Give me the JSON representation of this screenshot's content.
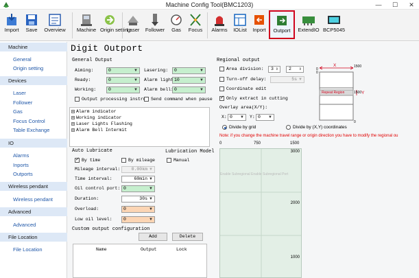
{
  "window": {
    "title": "Machine Config Tool(BMC1203)",
    "minimize": "—",
    "maximize": "☐",
    "close": "✕"
  },
  "toolbar": {
    "items": [
      {
        "label": "Import",
        "icon": "import-icon"
      },
      {
        "label": "Save",
        "icon": "save-icon"
      },
      {
        "label": "Overview",
        "icon": "overview-icon"
      },
      {
        "label": "Machine",
        "icon": "machine-icon"
      },
      {
        "label": "Origin setting",
        "icon": "origin-icon"
      },
      {
        "label": "Laser",
        "icon": "laser-icon"
      },
      {
        "label": "Follower",
        "icon": "follower-icon"
      },
      {
        "label": "Gas",
        "icon": "gas-icon"
      },
      {
        "label": "Focus",
        "icon": "focus-icon"
      },
      {
        "label": "Alarms",
        "icon": "alarms-icon"
      },
      {
        "label": "IOList",
        "icon": "iolist-icon"
      },
      {
        "label": "Inport",
        "icon": "inport-icon"
      },
      {
        "label": "Outport",
        "icon": "outport-icon"
      },
      {
        "label": "ExtendIO",
        "icon": "extendio-icon"
      },
      {
        "label": "BCP5045",
        "icon": "bcp5045-icon"
      }
    ],
    "selected": "Outport"
  },
  "sidebar": {
    "groups": [
      {
        "title": "Machine",
        "items": [
          "General",
          "Origin setting"
        ]
      },
      {
        "title": "Devices",
        "items": [
          "Laser",
          "Follower",
          "Gas",
          "Focus Control",
          "Table Exchange"
        ]
      },
      {
        "title": "IO",
        "items": [
          "Alarms",
          "Inports",
          "Outports"
        ]
      },
      {
        "title": "Wireless pendant",
        "items": [
          "Wireless pendant"
        ]
      },
      {
        "title": "Advanced",
        "items": [
          "Advanced"
        ]
      },
      {
        "title": "File Location",
        "items": [
          "File Location"
        ]
      }
    ]
  },
  "page": {
    "title": "Digit Outport",
    "general_output": {
      "heading": "General Output",
      "aiming": {
        "label": "Aiming:",
        "value": "0"
      },
      "lasering": {
        "label": "Lasering:",
        "value": "0"
      },
      "ready": {
        "label": "Ready:",
        "value": "0"
      },
      "alarm_light": {
        "label": "Alarm light",
        "value": "10"
      },
      "working": {
        "label": "Working:",
        "value": "0"
      },
      "alarm_bell": {
        "label": "Alarm bell:",
        "value": "0"
      },
      "output_processing": "Output processing instru",
      "send_command": "Send command when pause"
    },
    "tree": [
      "Alarm indicator",
      "Working indicator",
      "Laser Lights Flashing",
      "Alarm Bell Intermit"
    ],
    "auto_lubricate": {
      "heading": "Auto Lubricate",
      "by_time": "By time",
      "by_mileage": "By mileage",
      "mileage_interval": {
        "label": "Mileage interval:",
        "value": "0.00km"
      },
      "time_interval": {
        "label": "Time interval:",
        "value": "60min"
      },
      "oil_control_port": {
        "label": "Oil control port:",
        "value": "0"
      },
      "duration": {
        "label": "Duration:",
        "value": "30s"
      },
      "overload": {
        "label": "Overload:",
        "value": "0"
      },
      "low_oil_level": {
        "label": "Low oil level:",
        "value": "0"
      }
    },
    "lubrication_model": {
      "heading": "Lubrication Model",
      "manual": "Manual"
    },
    "custom_output": {
      "heading": "Custom output configuration",
      "add": "Add",
      "delete": "Delete",
      "columns": [
        "Name",
        "Output",
        "Lock"
      ]
    },
    "regional_output": {
      "heading": "Regional output",
      "area_division": {
        "label": "Area division:",
        "value1": "3",
        "value2": "2"
      },
      "turn_off_delay": {
        "label": "Turn-off delay:",
        "value": "5s"
      },
      "coordinate_edit": "Coordinate edit",
      "only_extract": "Only extract in cutting",
      "overlay_area": "Overlay area(X/Y):",
      "x": {
        "label": "X:",
        "value": "0"
      },
      "y": {
        "label": "Y:",
        "value": "0"
      },
      "divide_by_grid": "Divide by grid",
      "divide_by_xy": "Divide by (X,Y) coordinates",
      "note": "Note: if you change the machine travel range or origin direction you have to modify the regional ou",
      "diagram": {
        "x_label": "X",
        "y_label": "Y",
        "top_left": "0",
        "top_right": "1500",
        "bottom_left": "0",
        "left_num": "0",
        "right_num": "1500",
        "bottom_num": "0",
        "repeat_region": "Repeat Region"
      },
      "grid": {
        "x_ticks": [
          "0",
          "750",
          "1500"
        ],
        "y_ticks": [
          "3000",
          "2000",
          "1000"
        ],
        "watermark": "Enable Subregional Enable Subregional Port"
      }
    }
  }
}
